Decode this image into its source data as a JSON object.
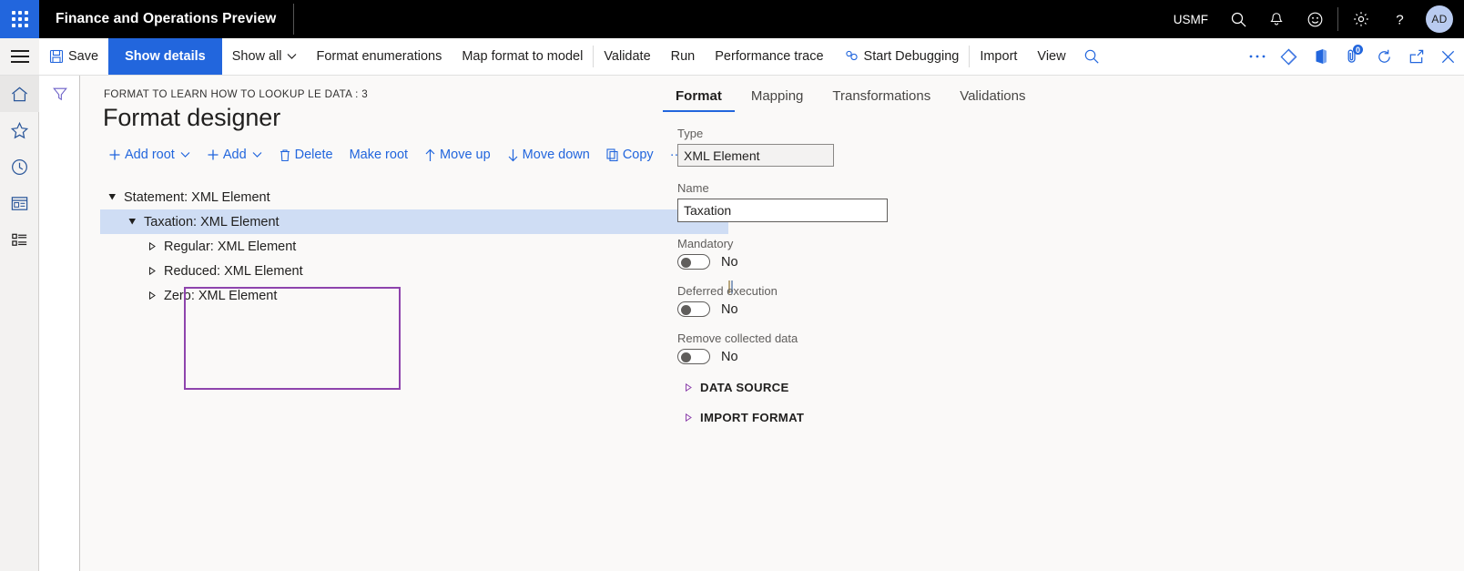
{
  "topbar": {
    "waffle_name": "app-launcher",
    "app_title": "Finance and Operations Preview",
    "company": "USMF",
    "icons": [
      "search-icon",
      "notification-bell-icon",
      "feedback-smiley-icon",
      "settings-gear-icon",
      "help-question-icon"
    ],
    "avatar_initials": "AD"
  },
  "commandbar": {
    "save_label": "Save",
    "show_details_label": "Show details",
    "show_all_label": "Show all",
    "format_enumerations_label": "Format enumerations",
    "map_format_to_model_label": "Map format to model",
    "validate_label": "Validate",
    "run_label": "Run",
    "performance_trace_label": "Performance trace",
    "start_debugging_label": "Start Debugging",
    "import_label": "Import",
    "view_label": "View",
    "attachment_badge": "0"
  },
  "page": {
    "breadcrumb": "FORMAT TO LEARN HOW TO LOOKUP LE DATA : 3",
    "title": "Format designer"
  },
  "actions": [
    {
      "label": "Add root",
      "icon": "plus-icon",
      "caret": true
    },
    {
      "label": "Add",
      "icon": "plus-icon",
      "caret": true
    },
    {
      "label": "Delete",
      "icon": "trash-icon",
      "caret": false
    },
    {
      "label": "Make root",
      "icon": "",
      "caret": false
    },
    {
      "label": "Move up",
      "icon": "arrow-up-icon",
      "caret": false
    },
    {
      "label": "Move down",
      "icon": "arrow-down-icon",
      "caret": false
    },
    {
      "label": "Copy",
      "icon": "copy-icon",
      "caret": false
    },
    {
      "label": "···",
      "icon": "",
      "caret": false
    }
  ],
  "tree": {
    "nodes": [
      {
        "label": "Statement: XML Element",
        "level": 1,
        "expanded": true,
        "selected": false
      },
      {
        "label": "Taxation: XML Element",
        "level": 2,
        "expanded": true,
        "selected": true
      },
      {
        "label": "Regular: XML Element",
        "level": 3,
        "expanded": false,
        "selected": false
      },
      {
        "label": "Reduced: XML Element",
        "level": 3,
        "expanded": false,
        "selected": false
      },
      {
        "label": "Zero: XML Element",
        "level": 3,
        "expanded": false,
        "selected": false
      }
    ]
  },
  "details": {
    "tabs": [
      {
        "label": "Format",
        "active": true
      },
      {
        "label": "Mapping",
        "active": false
      },
      {
        "label": "Transformations",
        "active": false
      },
      {
        "label": "Validations",
        "active": false
      }
    ],
    "type_label": "Type",
    "type_value": "XML Element",
    "name_label": "Name",
    "name_value": "Taxation",
    "mandatory_label": "Mandatory",
    "mandatory_value": "No",
    "deferred_label": "Deferred execution",
    "deferred_value": "No",
    "remove_collected_label": "Remove collected data",
    "remove_collected_value": "No",
    "sections": [
      {
        "label": "DATA SOURCE"
      },
      {
        "label": "IMPORT FORMAT"
      }
    ]
  },
  "colors": {
    "accent": "#2266dd",
    "link": "#2266dd",
    "annotation": "#8e44ad",
    "selected_row": "#cfddf4",
    "topbar_bg": "#000000",
    "content_bg": "#faf9f8"
  }
}
